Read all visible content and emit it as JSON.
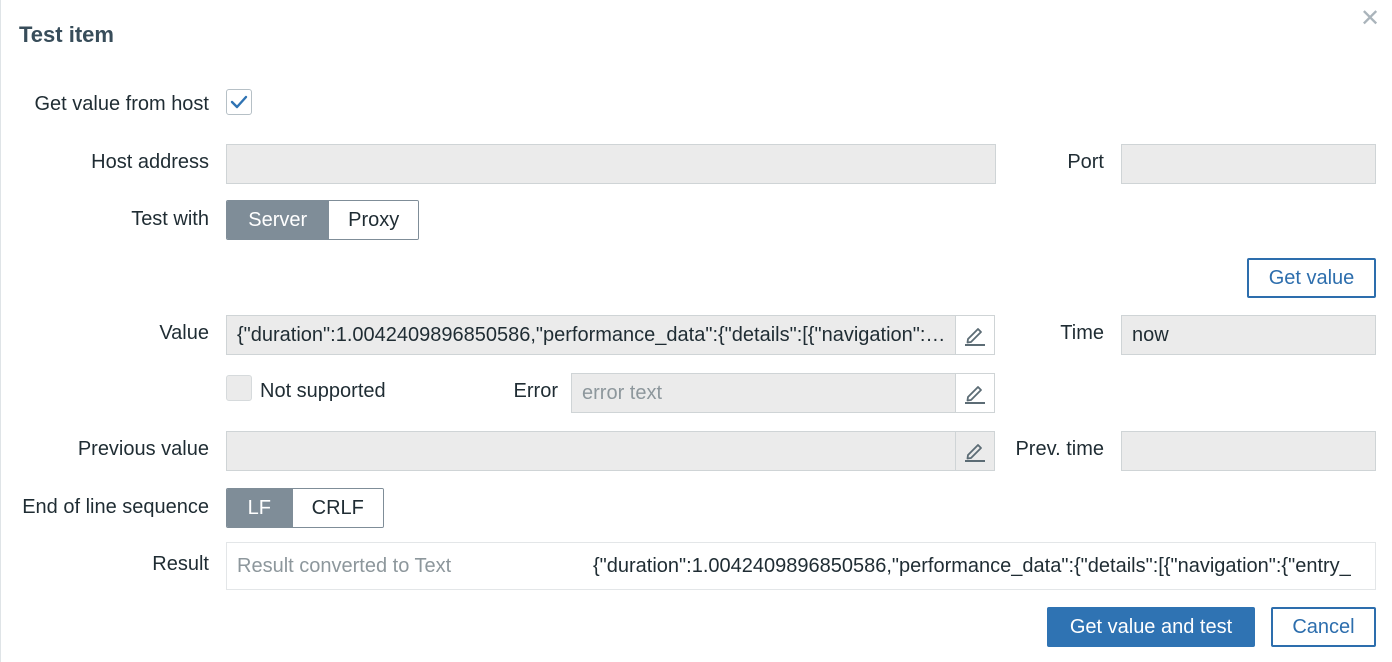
{
  "dialog": {
    "title": "Test item",
    "close_icon": "close-icon"
  },
  "form": {
    "get_value_from_host": {
      "label": "Get value from host",
      "checked": true
    },
    "host_address": {
      "label": "Host address",
      "value": ""
    },
    "port": {
      "label": "Port",
      "value": ""
    },
    "test_with": {
      "label": "Test with",
      "options": [
        "Server",
        "Proxy"
      ],
      "selected": "Server"
    },
    "get_value_button": "Get value",
    "value": {
      "label": "Value",
      "value": "{\"duration\":1.0042409896850586,\"performance_data\":{\"details\":[{\"navigation\":{\"entry_"
    },
    "time": {
      "label": "Time",
      "value": "now"
    },
    "not_supported": {
      "label": "Not supported",
      "checked": false
    },
    "error": {
      "label": "Error",
      "placeholder": "error text"
    },
    "previous_value": {
      "label": "Previous value",
      "value": ""
    },
    "prev_time": {
      "label": "Prev. time",
      "value": ""
    },
    "eol": {
      "label": "End of line sequence",
      "options": [
        "LF",
        "CRLF"
      ],
      "selected": "LF"
    },
    "result": {
      "label": "Result",
      "placeholder": "Result converted to Text",
      "value": "{\"duration\":1.0042409896850586,\"performance_data\":{\"details\":[{\"navigation\":{\"entry_"
    }
  },
  "footer": {
    "primary_button": "Get value and test",
    "cancel_button": "Cancel"
  },
  "colors": {
    "accent": "#2f73b3",
    "segment_active": "#7f8d98",
    "field_bg": "#ebebeb"
  }
}
